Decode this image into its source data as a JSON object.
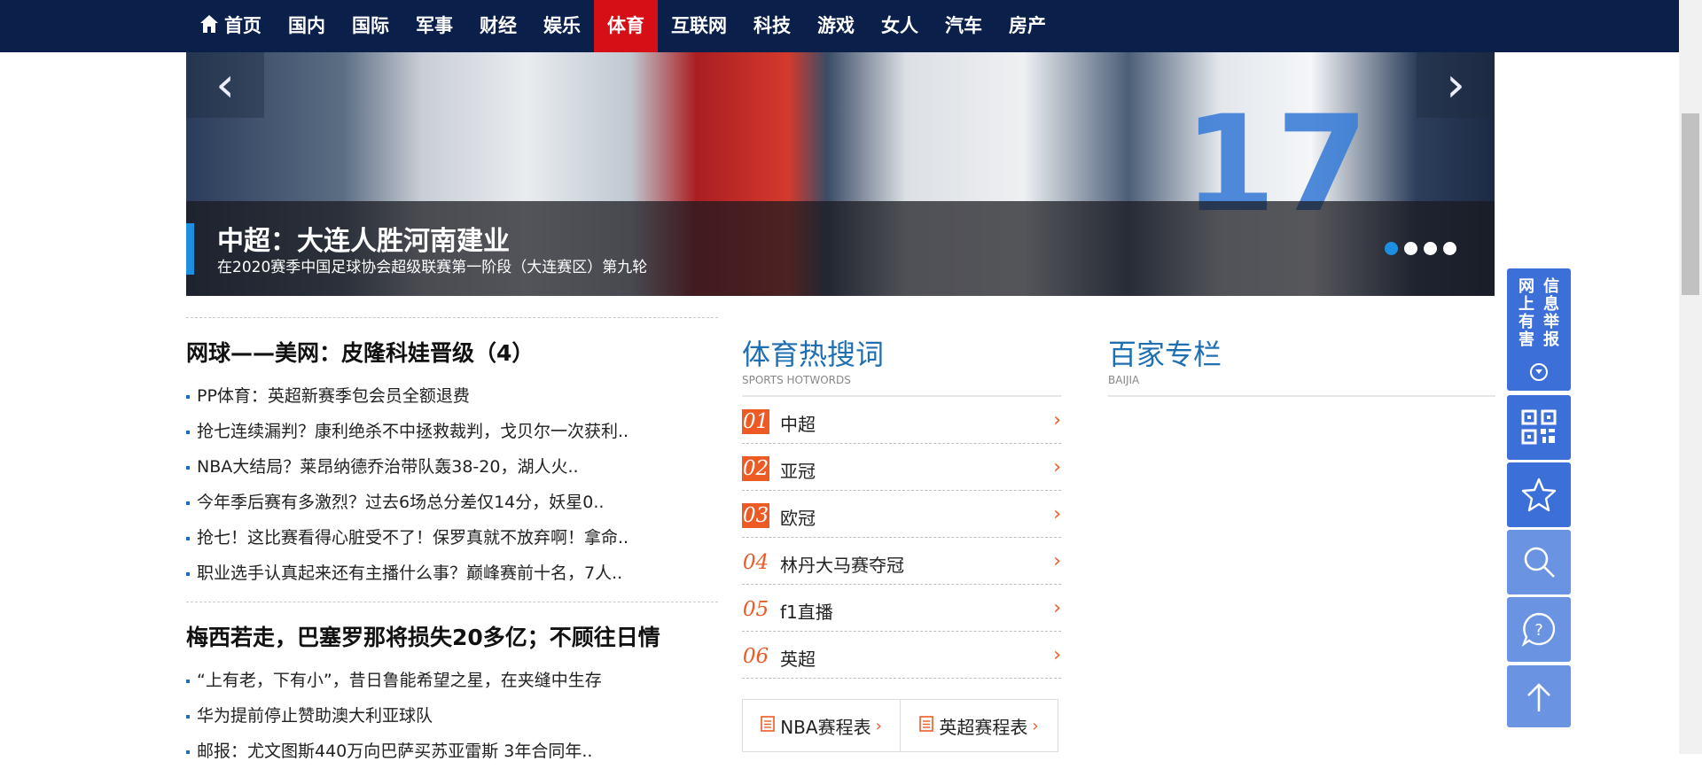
{
  "nav": {
    "items": [
      "首页",
      "国内",
      "国际",
      "军事",
      "财经",
      "娱乐",
      "体育",
      "互联网",
      "科技",
      "游戏",
      "女人",
      "汽车",
      "房产"
    ],
    "active": "体育"
  },
  "carousel": {
    "title": "中超：大连人胜河南建业",
    "subtitle": "在2020赛季中国足球协会超级联赛第一阶段（大连赛区）第九轮",
    "jersey_number": "17",
    "dots": 4,
    "active_dot": 1
  },
  "news": {
    "groups": [
      {
        "headline": "网球——美网：皮隆科娃晋级（4）",
        "items": [
          "PP体育：英超新赛季包会员全额退费",
          "抢七连续漏判？康利绝杀不中拯救裁判，戈贝尔一次获利..",
          "NBA大结局？莱昂纳德乔治带队轰38-20，湖人火..",
          "今年季后赛有多激烈？过去6场总分差仅14分，妖星0..",
          "抢七！这比赛看得心脏受不了！保罗真就不放弃啊！拿命..",
          "职业选手认真起来还有主播什么事？巅峰赛前十名，7人.."
        ]
      },
      {
        "headline": "梅西若走，巴塞罗那将损失20多亿；不顾往日情",
        "items": [
          "“上有老，下有小”，昔日鲁能希望之星，在夹缝中生存",
          "华为提前停止赞助澳大利亚球队",
          "邮报：尤文图斯440万向巴萨买苏亚雷斯 3年合同年.."
        ]
      }
    ]
  },
  "hotwords": {
    "title": "体育热搜词",
    "subtitle": "SPORTS HOTWORDS",
    "items": [
      {
        "rank": "01",
        "word": "中超"
      },
      {
        "rank": "02",
        "word": "亚冠"
      },
      {
        "rank": "03",
        "word": "欧冠"
      },
      {
        "rank": "04",
        "word": "林丹大马赛夺冠"
      },
      {
        "rank": "05",
        "word": "f1直播"
      },
      {
        "rank": "06",
        "word": "英超"
      }
    ],
    "schedules": [
      "NBA赛程表",
      "英超赛程表"
    ]
  },
  "baijia": {
    "title": "百家专栏",
    "subtitle": "BAIJIA"
  },
  "float_bar": {
    "report_text": "网上有害信息举报",
    "report_col1": "信息举报",
    "report_col2": "网上有害",
    "buttons": [
      "qr-code",
      "favorite",
      "search",
      "help",
      "back-to-top"
    ]
  },
  "colors": {
    "nav_bg": "#0a1f4a",
    "nav_active": "#d50f15",
    "accent_blue": "#1f6fb3",
    "hot_orange": "#ee5a24",
    "float_blue": "#3d6fd8"
  }
}
